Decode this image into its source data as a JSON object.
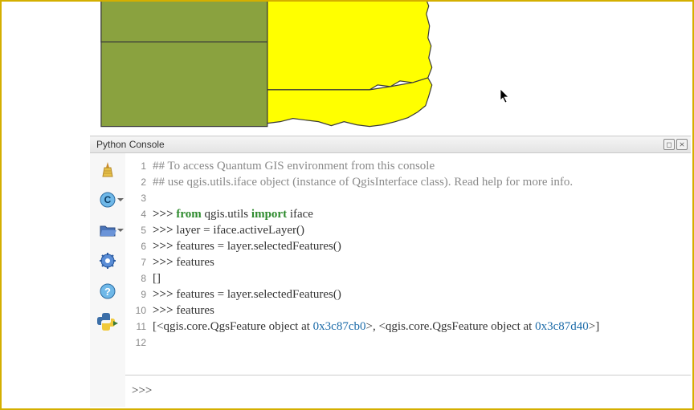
{
  "panel": {
    "title": "Python Console",
    "undock_title": "Undock",
    "close_title": "Close"
  },
  "toolbar": {
    "clear": "Clear console",
    "import": "Import class",
    "open": "Open script",
    "settings": "Settings",
    "help": "Help",
    "python": "Show editor"
  },
  "console_lines": [
    {
      "n": 1,
      "kind": "comment",
      "text": "## To access Quantum GIS environment from this console"
    },
    {
      "n": 2,
      "kind": "comment",
      "text": "## use qgis.utils.iface object (instance of QgisInterface class). Read help for more info."
    },
    {
      "n": 3,
      "kind": "blank",
      "text": ""
    },
    {
      "n": 4,
      "kind": "stmt",
      "prompt": ">>> ",
      "tokens": [
        {
          "t": "from ",
          "c": "keyword"
        },
        {
          "t": "qgis.utils ",
          "c": "plain"
        },
        {
          "t": "import ",
          "c": "keyword"
        },
        {
          "t": "iface",
          "c": "plain"
        }
      ]
    },
    {
      "n": 5,
      "kind": "stmt",
      "prompt": ">>> ",
      "tokens": [
        {
          "t": "layer = iface.activeLayer()",
          "c": "plain"
        }
      ]
    },
    {
      "n": 6,
      "kind": "stmt",
      "prompt": ">>> ",
      "tokens": [
        {
          "t": "features = layer.selectedFeatures()",
          "c": "plain"
        }
      ]
    },
    {
      "n": 7,
      "kind": "stmt",
      "prompt": ">>> ",
      "tokens": [
        {
          "t": "features",
          "c": "plain"
        }
      ]
    },
    {
      "n": 8,
      "kind": "out",
      "text": "[]"
    },
    {
      "n": 9,
      "kind": "stmt",
      "prompt": ">>> ",
      "tokens": [
        {
          "t": "features = layer.selectedFeatures()",
          "c": "plain"
        }
      ]
    },
    {
      "n": 10,
      "kind": "stmt",
      "prompt": ">>> ",
      "tokens": [
        {
          "t": "features",
          "c": "plain"
        }
      ]
    },
    {
      "n": 11,
      "kind": "out_addr",
      "segments": [
        {
          "t": "[<qgis.core.QgsFeature object at ",
          "c": "plain"
        },
        {
          "t": "0x3c87cb0",
          "c": "addr"
        },
        {
          "t": ">, <qgis.core.QgsFeature object at ",
          "c": "plain"
        },
        {
          "t": "0x3c87d40",
          "c": "addr"
        },
        {
          "t": ">]",
          "c": "plain"
        }
      ]
    },
    {
      "n": 12,
      "kind": "blank",
      "text": ""
    }
  ],
  "input": {
    "prompt": ">>>",
    "value": "",
    "placeholder": ""
  },
  "map": {
    "colors": {
      "selected": "#ffff00",
      "unselected": "#8aa23f",
      "stroke": "#3a3a3a",
      "background": "#ffffff"
    }
  }
}
